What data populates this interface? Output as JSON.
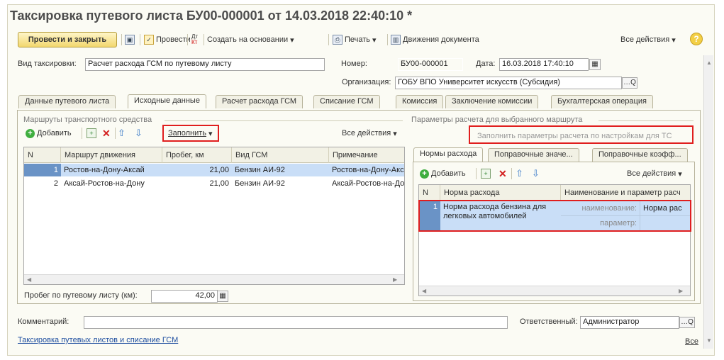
{
  "window": {
    "title": "Таксировка путевого листа БУ00-000001 от 14.03.2018 22:40:10 *"
  },
  "toolbar": {
    "post_close": "Провести и закрыть",
    "post": "Провести",
    "create_based": "Создать на основании",
    "print": "Печать",
    "movements": "Движения документа",
    "all_actions": "Все действия",
    "help": "?"
  },
  "header": {
    "type_label": "Вид таксировки:",
    "type_value": "Расчет расхода ГСМ по путевому листу",
    "number_label": "Номер:",
    "number_value": "БУ00-000001",
    "date_label": "Дата:",
    "date_value": "16.03.2018 17:40:10",
    "org_label": "Организация:",
    "org_value": "ГОБУ ВПО Университет искусств (Субсидия)"
  },
  "tabs": [
    {
      "label": "Данные путевого листа"
    },
    {
      "label": "Исходные данные"
    },
    {
      "label": "Расчет расхода ГСМ"
    },
    {
      "label": "Списание ГСМ"
    },
    {
      "label": "Комиссия"
    },
    {
      "label": "Заключение комиссии"
    },
    {
      "label": "Бухгалтерская операция"
    }
  ],
  "routes": {
    "group_title": "Маршруты транспортного средства",
    "add": "Добавить",
    "fill": "Заполнить",
    "all_actions": "Все действия",
    "columns": [
      "N",
      "Маршрут движения",
      "Пробег, км",
      "Вид ГСМ",
      "Примечание"
    ],
    "rows": [
      {
        "n": "1",
        "route": "Ростов-на-Дону-Аксай",
        "mileage": "21,00",
        "fuel": "Бензин АИ-92",
        "note": "Ростов-на-Дону-Аксай"
      },
      {
        "n": "2",
        "route": "Аксай-Ростов-на-Дону",
        "mileage": "21,00",
        "fuel": "Бензин АИ-92",
        "note": "Аксай-Ростов-на-Дону"
      }
    ],
    "total_label": "Пробег по путевому листу (км):",
    "total_value": "42,00"
  },
  "params": {
    "group_title": "Параметры расчета для выбранного маршрута",
    "fill_btn": "Заполнить параметры расчета по настройкам для ТС",
    "subtabs": [
      {
        "label": "Нормы расхода"
      },
      {
        "label": "Поправочные значе..."
      },
      {
        "label": "Поправочные коэфф..."
      }
    ],
    "add": "Добавить",
    "all_actions": "Все действия",
    "columns": [
      "N",
      "Норма расхода",
      "Наименование и параметр расч"
    ],
    "rows": [
      {
        "n": "1",
        "norm": "Норма расхода бензина для легковых автомобилей",
        "name_label": "наименование:",
        "name_value": "Норма рас",
        "param_label": "параметр:",
        "param_value": ""
      }
    ]
  },
  "footer": {
    "comment_label": "Комментарий:",
    "comment_value": "",
    "responsible_label": "Ответственный:",
    "responsible_value": "Администратор",
    "link": "Таксировка путевых листов и списание ГСМ",
    "all_link": "Все"
  },
  "colors": {
    "highlight_red": "#e01e1e",
    "selected_row": "#c9def7",
    "link_blue": "#1f4fa0",
    "primary_button": "#f2d76e"
  }
}
